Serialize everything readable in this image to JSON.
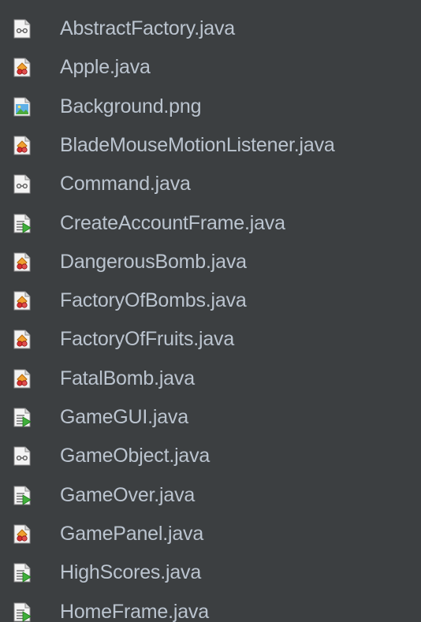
{
  "panel": {
    "background": "#3c3f41",
    "text_color": "#bbc4cf"
  },
  "files": [
    {
      "name": "AbstractFactory.java",
      "icon": "interface-file-icon"
    },
    {
      "name": "Apple.java",
      "icon": "class-file-icon"
    },
    {
      "name": "Background.png",
      "icon": "image-file-icon"
    },
    {
      "name": "BladeMouseMotionListener.java",
      "icon": "class-file-icon"
    },
    {
      "name": "Command.java",
      "icon": "interface-file-icon"
    },
    {
      "name": "CreateAccountFrame.java",
      "icon": "runnable-class-file-icon"
    },
    {
      "name": "DangerousBomb.java",
      "icon": "class-file-icon"
    },
    {
      "name": "FactoryOfBombs.java",
      "icon": "class-file-icon"
    },
    {
      "name": "FactoryOfFruits.java",
      "icon": "class-file-icon"
    },
    {
      "name": "FatalBomb.java",
      "icon": "class-file-icon"
    },
    {
      "name": "GameGUI.java",
      "icon": "runnable-class-file-icon"
    },
    {
      "name": "GameObject.java",
      "icon": "interface-file-icon"
    },
    {
      "name": "GameOver.java",
      "icon": "runnable-class-file-icon"
    },
    {
      "name": "GamePanel.java",
      "icon": "class-file-icon"
    },
    {
      "name": "HighScores.java",
      "icon": "runnable-class-file-icon"
    },
    {
      "name": "HomeFrame.java",
      "icon": "runnable-class-file-icon"
    }
  ]
}
